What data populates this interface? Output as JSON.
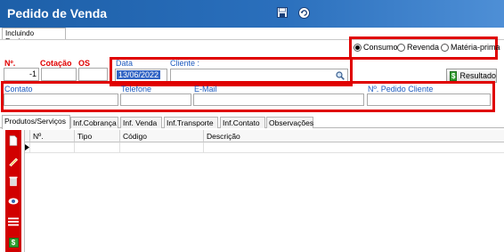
{
  "window": {
    "title": "Pedido de Venda"
  },
  "toolbar": {
    "save_icon": "floppy-disk-icon",
    "back_icon": "undo-arrow-icon"
  },
  "tab": {
    "label": "Incluindo Registro"
  },
  "radios": {
    "selected": "Consumo",
    "options": [
      {
        "label": "Consumo",
        "checked": true
      },
      {
        "label": "Revenda",
        "checked": false
      },
      {
        "label": "Matéria-prima",
        "checked": false
      }
    ]
  },
  "fields": {
    "numero_label": "Nº.",
    "numero_value": "-1",
    "cotacao_label": "Cotação",
    "os_label": "OS",
    "data_label": "Data",
    "data_value": "13/06/2022",
    "cliente_label": "Cliente :",
    "contato_label": "Contato",
    "telefone_label": "Telefone",
    "email_label": "E-Mail",
    "pedido_cliente_label": "Nº. Pedido Cliente"
  },
  "buttons": {
    "resultado_label": "Resultado"
  },
  "subtabs": [
    "Produtos/Serviços",
    "Inf.Cobrança",
    "Inf. Venda",
    "Inf.Transporte",
    "Inf.Contato",
    "Observações"
  ],
  "grid": {
    "columns": [
      "Nº.",
      "Tipo",
      "Código",
      "Descrição"
    ]
  },
  "colors": {
    "highlight": "#e00000",
    "titlebar": "#1d5fa8",
    "sidebar": "#d10000",
    "field_label": "#1e5bbf"
  }
}
